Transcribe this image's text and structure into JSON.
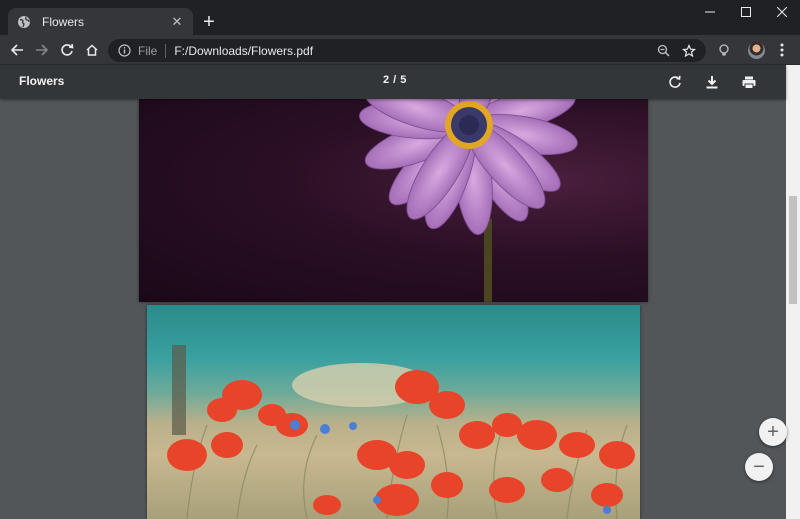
{
  "browser": {
    "tab": {
      "title": "Flowers",
      "favicon": "globe-icon"
    },
    "new_tab_symbol": "+",
    "omnibox": {
      "scheme_label": "File",
      "url": "F:/Downloads/Flowers.pdf"
    }
  },
  "pdf_viewer": {
    "title": "Flowers",
    "page_counter": "2 / 5",
    "pages": [
      {
        "content": "purple daisy photo"
      },
      {
        "content": "red poppies field photo"
      }
    ],
    "zoom_in_symbol": "+",
    "zoom_out_symbol": "−"
  },
  "colors": {
    "tab_strip": "#202124",
    "toolbar": "#35363a",
    "pdf_toolbar": "#323639",
    "viewer_background": "#525659"
  }
}
